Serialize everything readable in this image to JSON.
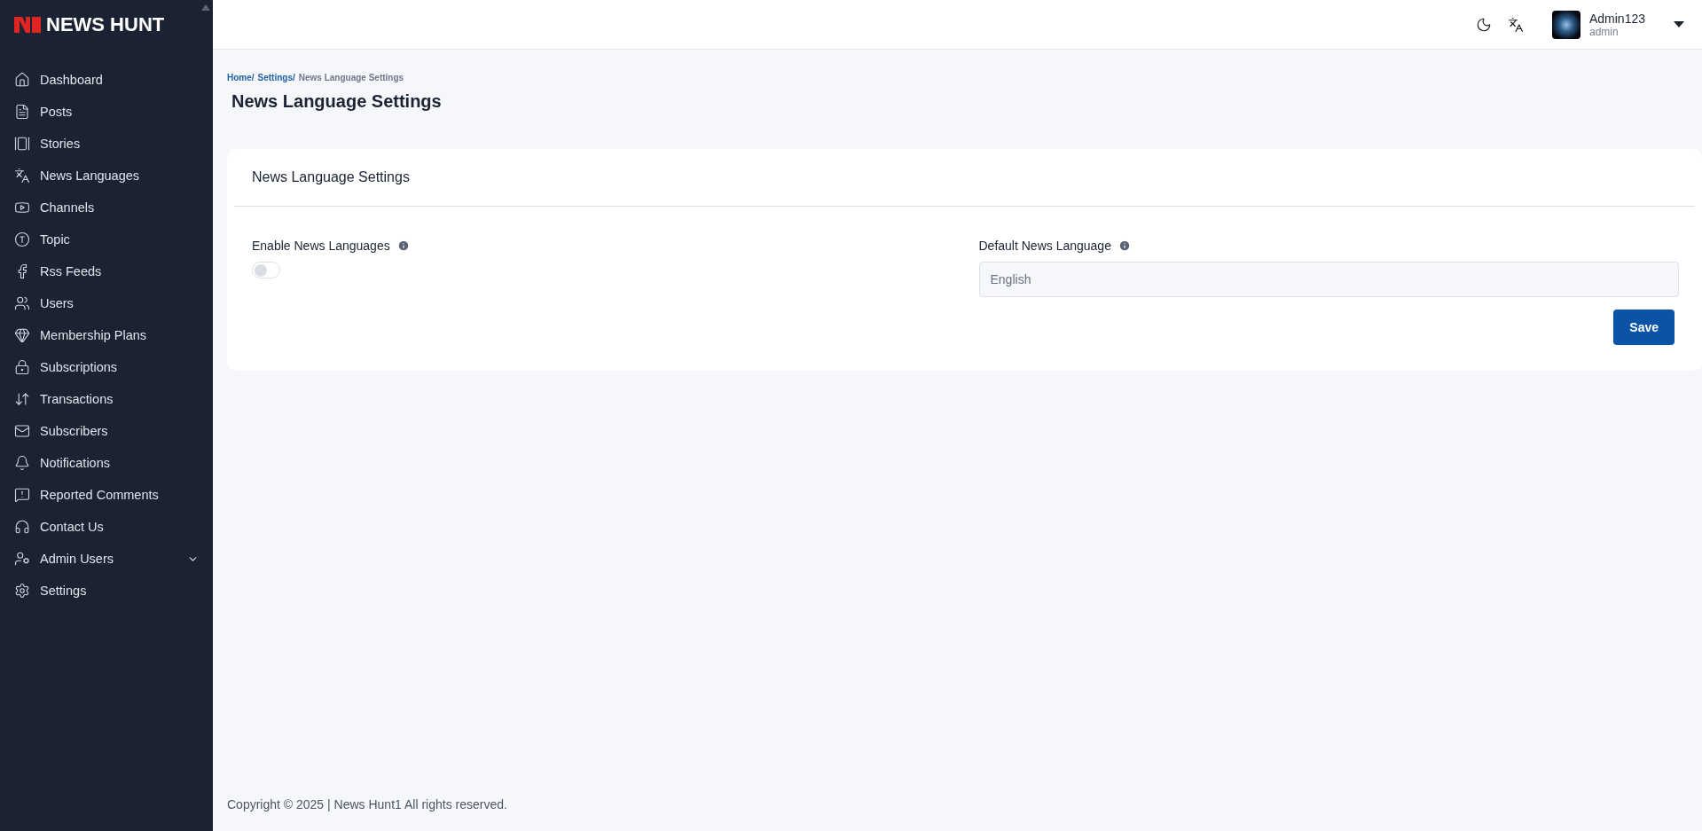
{
  "sidebar": {
    "logo": "NEWS HUNT",
    "items": [
      {
        "label": "Dashboard",
        "kind": "link"
      },
      {
        "label": "Posts",
        "kind": "link"
      },
      {
        "label": "Stories",
        "kind": "link"
      },
      {
        "label": "News Languages",
        "kind": "link"
      },
      {
        "label": "Channels",
        "kind": "link"
      },
      {
        "label": "Topic",
        "kind": "link"
      },
      {
        "label": "Rss Feeds",
        "kind": "link"
      },
      {
        "label": "Users",
        "kind": "link"
      },
      {
        "label": "Membership Plans",
        "kind": "link"
      },
      {
        "label": "Subscriptions",
        "kind": "link"
      },
      {
        "label": "Transactions",
        "kind": "link"
      },
      {
        "label": "Subscribers",
        "kind": "link"
      },
      {
        "label": "Notifications",
        "kind": "link"
      },
      {
        "label": "Reported Comments",
        "kind": "link"
      },
      {
        "label": "Contact Us",
        "kind": "link"
      },
      {
        "label": "Admin Users",
        "kind": "group",
        "expanded": false
      },
      {
        "label": "Settings",
        "kind": "link"
      }
    ]
  },
  "header": {
    "user_name": "Admin123",
    "user_role": "admin"
  },
  "breadcrumb": [
    "Home/",
    "Settings/",
    "News Language Settings"
  ],
  "page_title": "News Language Settings",
  "card": {
    "title": "News Language Settings",
    "enable": {
      "label": "Enable News Languages",
      "on": false
    },
    "default_language": {
      "label": "Default News Language",
      "value": "English"
    },
    "save_button": "Save"
  },
  "footer": "Copyright © 2025 | News Hunt1 All rights reserved."
}
